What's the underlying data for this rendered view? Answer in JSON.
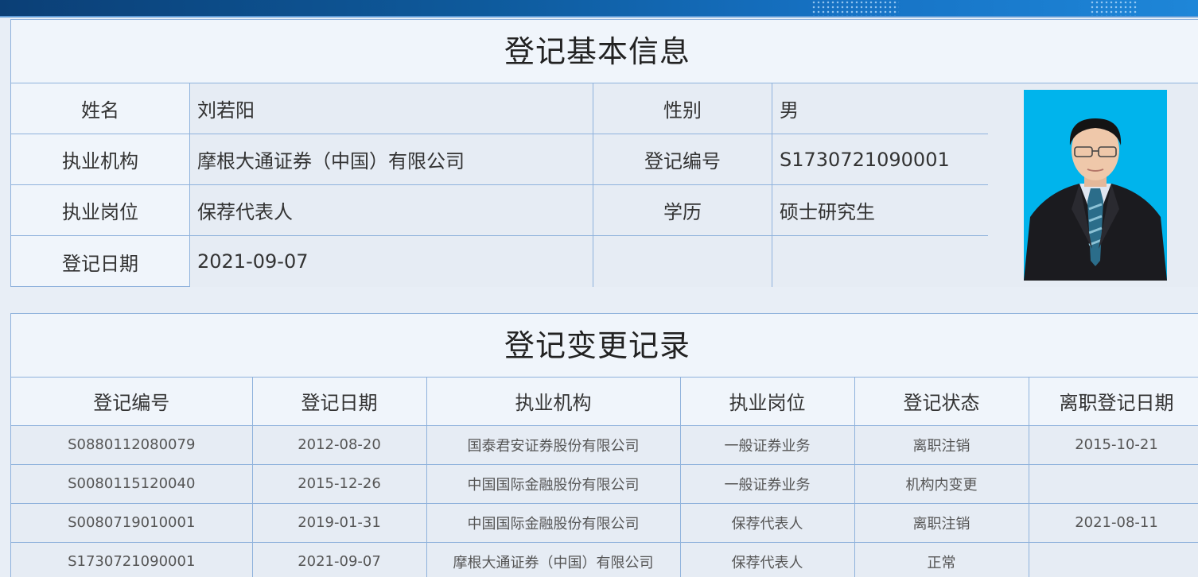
{
  "basic_info": {
    "title": "登记基本信息",
    "fields": {
      "name_label": "姓名",
      "name_value": "刘若阳",
      "gender_label": "性别",
      "gender_value": "男",
      "org_label": "执业机构",
      "org_value": "摩根大通证券（中国）有限公司",
      "reg_no_label": "登记编号",
      "reg_no_value": "S1730721090001",
      "position_label": "执业岗位",
      "position_value": "保荐代表人",
      "education_label": "学历",
      "education_value": "硕士研究生",
      "reg_date_label": "登记日期",
      "reg_date_value": "2021-09-07"
    },
    "photo_bg_color": "#00b4ec"
  },
  "change_records": {
    "title": "登记变更记录",
    "headers": [
      "登记编号",
      "登记日期",
      "执业机构",
      "执业岗位",
      "登记状态",
      "离职登记日期"
    ],
    "rows": [
      [
        "S0880112080079",
        "2012-08-20",
        "国泰君安证券股份有限公司",
        "一般证券业务",
        "离职注销",
        "2015-10-21"
      ],
      [
        "S0080115120040",
        "2015-12-26",
        "中国国际金融股份有限公司",
        "一般证券业务",
        "机构内变更",
        ""
      ],
      [
        "S0080719010001",
        "2019-01-31",
        "中国国际金融股份有限公司",
        "保荐代表人",
        "离职注销",
        "2021-08-11"
      ],
      [
        "S1730721090001",
        "2021-09-07",
        "摩根大通证券（中国）有限公司",
        "保荐代表人",
        "正常",
        ""
      ]
    ]
  },
  "colors": {
    "border": "#8fb2dc",
    "panel_bg": "#f0f5fb",
    "cell_bg": "#e6ecf4",
    "banner": "#0e5a9c"
  }
}
